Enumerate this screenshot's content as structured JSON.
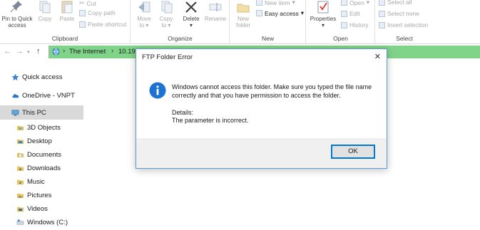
{
  "ribbon": {
    "clipboard": {
      "label": "Clipboard",
      "pin_label_1": "Pin to Quick",
      "pin_label_2": "access",
      "copy_label": "Copy",
      "paste_label": "Paste",
      "cut_label": "Cut",
      "copy_path_label": "Copy path",
      "paste_shortcut_label": "Paste shortcut"
    },
    "organize": {
      "label": "Organize",
      "move_to_1": "Move",
      "move_to_2": "to",
      "copy_to_1": "Copy",
      "copy_to_2": "to",
      "delete_1": "Delete",
      "rename_label": "Rename"
    },
    "new": {
      "label": "New",
      "new_folder_1": "New",
      "new_folder_2": "folder",
      "new_item_label": "New item",
      "easy_access_label": "Easy access"
    },
    "open": {
      "label": "Open",
      "properties_label": "Properties",
      "open_label": "Open",
      "edit_label": "Edit",
      "history_label": "History"
    },
    "select": {
      "label": "Select",
      "select_all_label": "Select all",
      "select_none_label": "Select none",
      "invert_selection_label": "Invert selection"
    }
  },
  "address": {
    "crumb_1": "The Internet",
    "crumb_2": "10.193"
  },
  "navpane": {
    "items": [
      {
        "label": "Quick access",
        "icon": "star-icon"
      },
      {
        "label": "OneDrive - VNPT",
        "icon": "cloud-icon"
      },
      {
        "label": "This PC",
        "icon": "pc-icon"
      },
      {
        "label": "3D Objects",
        "icon": "folder-icon"
      },
      {
        "label": "Desktop",
        "icon": "folder-icon"
      },
      {
        "label": "Documents",
        "icon": "folder-icon"
      },
      {
        "label": "Downloads",
        "icon": "folder-icon"
      },
      {
        "label": "Music",
        "icon": "folder-icon"
      },
      {
        "label": "Pictures",
        "icon": "folder-icon"
      },
      {
        "label": "Videos",
        "icon": "folder-icon"
      },
      {
        "label": "Windows (C:)",
        "icon": "drive-icon"
      }
    ]
  },
  "dialog": {
    "title": "FTP Folder Error",
    "message": "Windows cannot access this folder. Make sure you typed the file name correctly and that you have permission to access the folder.",
    "details_label": "Details:",
    "details_text": "The parameter is incorrect.",
    "ok_label": "OK",
    "close_glyph": "✕"
  },
  "colors": {
    "address_bar": "#80d48a",
    "selection": "#cce8ff",
    "accent": "#0078d7"
  }
}
